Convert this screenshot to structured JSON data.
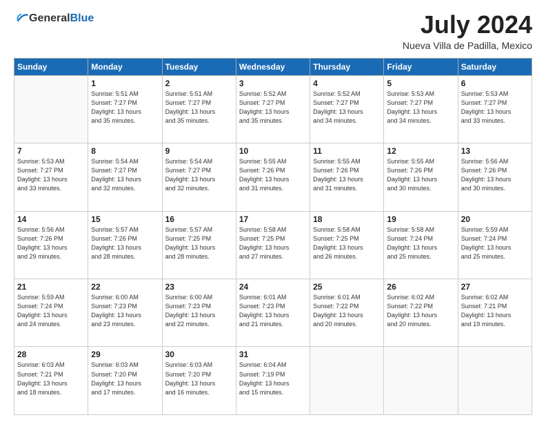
{
  "header": {
    "logo_general": "General",
    "logo_blue": "Blue",
    "month": "July 2024",
    "location": "Nueva Villa de Padilla, Mexico"
  },
  "weekdays": [
    "Sunday",
    "Monday",
    "Tuesday",
    "Wednesday",
    "Thursday",
    "Friday",
    "Saturday"
  ],
  "weeks": [
    [
      {
        "day": "",
        "sunrise": "",
        "sunset": "",
        "daylight": ""
      },
      {
        "day": "1",
        "sunrise": "Sunrise: 5:51 AM",
        "sunset": "Sunset: 7:27 PM",
        "daylight": "Daylight: 13 hours and 35 minutes."
      },
      {
        "day": "2",
        "sunrise": "Sunrise: 5:51 AM",
        "sunset": "Sunset: 7:27 PM",
        "daylight": "Daylight: 13 hours and 35 minutes."
      },
      {
        "day": "3",
        "sunrise": "Sunrise: 5:52 AM",
        "sunset": "Sunset: 7:27 PM",
        "daylight": "Daylight: 13 hours and 35 minutes."
      },
      {
        "day": "4",
        "sunrise": "Sunrise: 5:52 AM",
        "sunset": "Sunset: 7:27 PM",
        "daylight": "Daylight: 13 hours and 34 minutes."
      },
      {
        "day": "5",
        "sunrise": "Sunrise: 5:53 AM",
        "sunset": "Sunset: 7:27 PM",
        "daylight": "Daylight: 13 hours and 34 minutes."
      },
      {
        "day": "6",
        "sunrise": "Sunrise: 5:53 AM",
        "sunset": "Sunset: 7:27 PM",
        "daylight": "Daylight: 13 hours and 33 minutes."
      }
    ],
    [
      {
        "day": "7",
        "sunrise": "Sunrise: 5:53 AM",
        "sunset": "Sunset: 7:27 PM",
        "daylight": "Daylight: 13 hours and 33 minutes."
      },
      {
        "day": "8",
        "sunrise": "Sunrise: 5:54 AM",
        "sunset": "Sunset: 7:27 PM",
        "daylight": "Daylight: 13 hours and 32 minutes."
      },
      {
        "day": "9",
        "sunrise": "Sunrise: 5:54 AM",
        "sunset": "Sunset: 7:27 PM",
        "daylight": "Daylight: 13 hours and 32 minutes."
      },
      {
        "day": "10",
        "sunrise": "Sunrise: 5:55 AM",
        "sunset": "Sunset: 7:26 PM",
        "daylight": "Daylight: 13 hours and 31 minutes."
      },
      {
        "day": "11",
        "sunrise": "Sunrise: 5:55 AM",
        "sunset": "Sunset: 7:26 PM",
        "daylight": "Daylight: 13 hours and 31 minutes."
      },
      {
        "day": "12",
        "sunrise": "Sunrise: 5:55 AM",
        "sunset": "Sunset: 7:26 PM",
        "daylight": "Daylight: 13 hours and 30 minutes."
      },
      {
        "day": "13",
        "sunrise": "Sunrise: 5:56 AM",
        "sunset": "Sunset: 7:26 PM",
        "daylight": "Daylight: 13 hours and 30 minutes."
      }
    ],
    [
      {
        "day": "14",
        "sunrise": "Sunrise: 5:56 AM",
        "sunset": "Sunset: 7:26 PM",
        "daylight": "Daylight: 13 hours and 29 minutes."
      },
      {
        "day": "15",
        "sunrise": "Sunrise: 5:57 AM",
        "sunset": "Sunset: 7:26 PM",
        "daylight": "Daylight: 13 hours and 28 minutes."
      },
      {
        "day": "16",
        "sunrise": "Sunrise: 5:57 AM",
        "sunset": "Sunset: 7:25 PM",
        "daylight": "Daylight: 13 hours and 28 minutes."
      },
      {
        "day": "17",
        "sunrise": "Sunrise: 5:58 AM",
        "sunset": "Sunset: 7:25 PM",
        "daylight": "Daylight: 13 hours and 27 minutes."
      },
      {
        "day": "18",
        "sunrise": "Sunrise: 5:58 AM",
        "sunset": "Sunset: 7:25 PM",
        "daylight": "Daylight: 13 hours and 26 minutes."
      },
      {
        "day": "19",
        "sunrise": "Sunrise: 5:58 AM",
        "sunset": "Sunset: 7:24 PM",
        "daylight": "Daylight: 13 hours and 25 minutes."
      },
      {
        "day": "20",
        "sunrise": "Sunrise: 5:59 AM",
        "sunset": "Sunset: 7:24 PM",
        "daylight": "Daylight: 13 hours and 25 minutes."
      }
    ],
    [
      {
        "day": "21",
        "sunrise": "Sunrise: 5:59 AM",
        "sunset": "Sunset: 7:24 PM",
        "daylight": "Daylight: 13 hours and 24 minutes."
      },
      {
        "day": "22",
        "sunrise": "Sunrise: 6:00 AM",
        "sunset": "Sunset: 7:23 PM",
        "daylight": "Daylight: 13 hours and 23 minutes."
      },
      {
        "day": "23",
        "sunrise": "Sunrise: 6:00 AM",
        "sunset": "Sunset: 7:23 PM",
        "daylight": "Daylight: 13 hours and 22 minutes."
      },
      {
        "day": "24",
        "sunrise": "Sunrise: 6:01 AM",
        "sunset": "Sunset: 7:23 PM",
        "daylight": "Daylight: 13 hours and 21 minutes."
      },
      {
        "day": "25",
        "sunrise": "Sunrise: 6:01 AM",
        "sunset": "Sunset: 7:22 PM",
        "daylight": "Daylight: 13 hours and 20 minutes."
      },
      {
        "day": "26",
        "sunrise": "Sunrise: 6:02 AM",
        "sunset": "Sunset: 7:22 PM",
        "daylight": "Daylight: 13 hours and 20 minutes."
      },
      {
        "day": "27",
        "sunrise": "Sunrise: 6:02 AM",
        "sunset": "Sunset: 7:21 PM",
        "daylight": "Daylight: 13 hours and 19 minutes."
      }
    ],
    [
      {
        "day": "28",
        "sunrise": "Sunrise: 6:03 AM",
        "sunset": "Sunset: 7:21 PM",
        "daylight": "Daylight: 13 hours and 18 minutes."
      },
      {
        "day": "29",
        "sunrise": "Sunrise: 6:03 AM",
        "sunset": "Sunset: 7:20 PM",
        "daylight": "Daylight: 13 hours and 17 minutes."
      },
      {
        "day": "30",
        "sunrise": "Sunrise: 6:03 AM",
        "sunset": "Sunset: 7:20 PM",
        "daylight": "Daylight: 13 hours and 16 minutes."
      },
      {
        "day": "31",
        "sunrise": "Sunrise: 6:04 AM",
        "sunset": "Sunset: 7:19 PM",
        "daylight": "Daylight: 13 hours and 15 minutes."
      },
      {
        "day": "",
        "sunrise": "",
        "sunset": "",
        "daylight": ""
      },
      {
        "day": "",
        "sunrise": "",
        "sunset": "",
        "daylight": ""
      },
      {
        "day": "",
        "sunrise": "",
        "sunset": "",
        "daylight": ""
      }
    ]
  ]
}
